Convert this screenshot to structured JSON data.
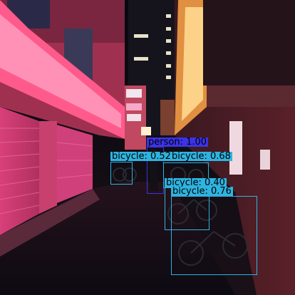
{
  "scene": "night street alley with neon shop signs and parked bicycles",
  "detections": [
    {
      "id": "det-person",
      "label": "person: 1.00",
      "color": "#3b33e6"
    },
    {
      "id": "det-bicycle-1",
      "label": "bicycle: 0.52",
      "color": "#2fb3e0"
    },
    {
      "id": "det-bicycle-2",
      "label": "bicycle: 0.68",
      "color": "#2fb3e0"
    },
    {
      "id": "det-bicycle-3",
      "label": "bicycle: 0.40",
      "color": "#2fb3e0"
    },
    {
      "id": "det-bicycle-4",
      "label": "bicycle: 0.76",
      "color": "#2fb3e0"
    }
  ],
  "colors": {
    "person": "#3b33e6",
    "bicycle": "#2fb3e0"
  }
}
